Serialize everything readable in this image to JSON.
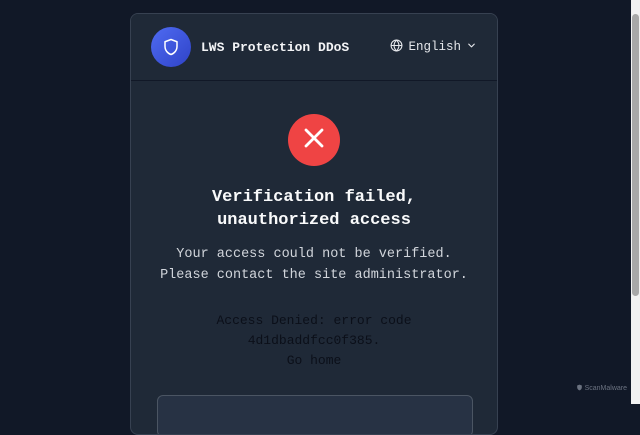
{
  "header": {
    "brand": "LWS Protection DDoS",
    "language": "English"
  },
  "status": {
    "title_line1": "Verification failed,",
    "title_line2": "unauthorized access",
    "message_line1": "Your access could not be verified.",
    "message_line2": "Please contact the site administrator."
  },
  "denied": {
    "line1": "Access Denied: error code",
    "line2": "4d1dbaddfcc0f385.",
    "home_link": "Go home"
  },
  "watermark": "ScanMalware",
  "icons": [
    "shield-icon",
    "globe-icon",
    "chevron-down-icon",
    "x-icon"
  ],
  "colors": {
    "accent": "#3b4fd9",
    "error": "#ef4444",
    "background": "#111827",
    "card": "#1f2937"
  }
}
